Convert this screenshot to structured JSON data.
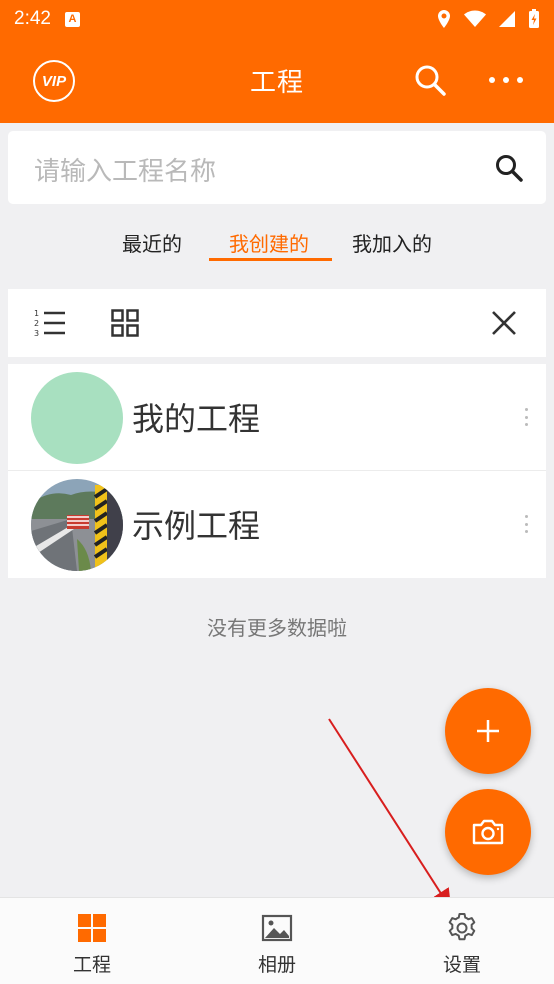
{
  "status_bar": {
    "time": "2:42",
    "app_icon": "A"
  },
  "app_bar": {
    "vip_label": "VIP",
    "title": "工程"
  },
  "search": {
    "placeholder": "请输入工程名称"
  },
  "tabs": [
    {
      "label": "最近的",
      "active": false
    },
    {
      "label": "我创建的",
      "active": true
    },
    {
      "label": "我加入的",
      "active": false
    }
  ],
  "projects": [
    {
      "name": "我的工程",
      "thumb_color": "#a8e0c0"
    },
    {
      "name": "示例工程",
      "thumb": "road-photo"
    }
  ],
  "list_footer": "没有更多数据啦",
  "bottom_nav": [
    {
      "label": "工程",
      "icon": "grid-icon",
      "active": true
    },
    {
      "label": "相册",
      "icon": "image-icon",
      "active": false
    },
    {
      "label": "设置",
      "icon": "gear-icon",
      "active": false
    }
  ],
  "colors": {
    "accent": "#ff6a00",
    "annotation_arrow": "#d81e1e"
  }
}
